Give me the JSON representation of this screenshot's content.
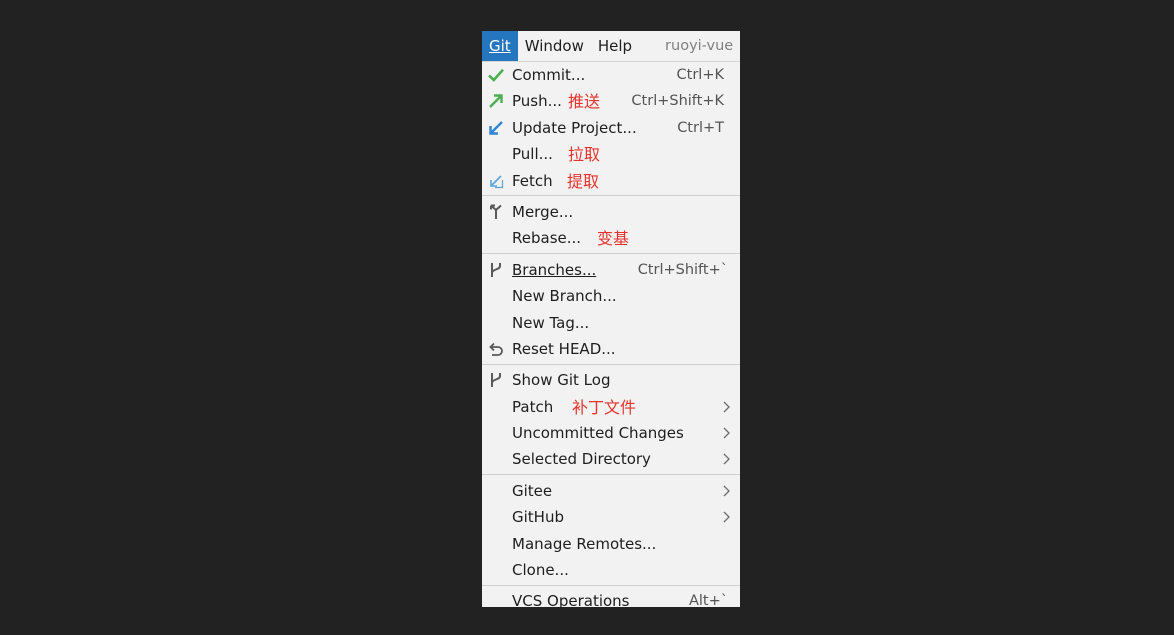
{
  "menubar": {
    "git": "Git",
    "window": "Window",
    "help": "Help",
    "project": "ruoyi-vue"
  },
  "menu": {
    "commit": {
      "label": "Commit...",
      "shortcut": "Ctrl+K"
    },
    "push": {
      "label": "Push...",
      "annotation": "推送",
      "shortcut": "Ctrl+Shift+K"
    },
    "update": {
      "label": "Update Project...",
      "shortcut": "Ctrl+T"
    },
    "pull": {
      "label": "Pull...",
      "annotation": "拉取"
    },
    "fetch": {
      "label": "Fetch",
      "annotation": "提取"
    },
    "merge": {
      "label": "Merge..."
    },
    "rebase": {
      "label": "Rebase...",
      "annotation": "变基"
    },
    "branches": {
      "label": "Branches...",
      "shortcut": "Ctrl+Shift+`"
    },
    "new_branch": {
      "label": "New Branch..."
    },
    "new_tag": {
      "label": "New Tag..."
    },
    "reset_head": {
      "label": "Reset HEAD..."
    },
    "show_git_log": {
      "label": "Show Git Log"
    },
    "patch": {
      "label": "Patch",
      "annotation": "补丁文件"
    },
    "uncommitted": {
      "label": "Uncommitted Changes"
    },
    "selected_dir": {
      "label": "Selected Directory"
    },
    "gitee": {
      "label": "Gitee"
    },
    "github": {
      "label": "GitHub"
    },
    "manage_remotes": {
      "label": "Manage Remotes..."
    },
    "clone": {
      "label": "Clone..."
    },
    "vcs_operations": {
      "label": "VCS Operations",
      "shortcut": "Alt+`"
    }
  },
  "colors": {
    "background": "#222222",
    "menu_bg": "#f2f2f2",
    "active_menu": "#2675bf",
    "annotation": "#e8322c",
    "check_green": "#4caf50",
    "update_blue": "#2f86d6"
  },
  "icons": {
    "commit": "check-icon",
    "push": "push-arrow-icon",
    "update": "update-arrow-icon",
    "fetch": "fetch-arrow-icon",
    "merge": "merge-icon",
    "branches": "branch-icon",
    "reset_head": "undo-icon",
    "show_git_log": "branch-icon",
    "submenu": "chevron-right-icon"
  }
}
